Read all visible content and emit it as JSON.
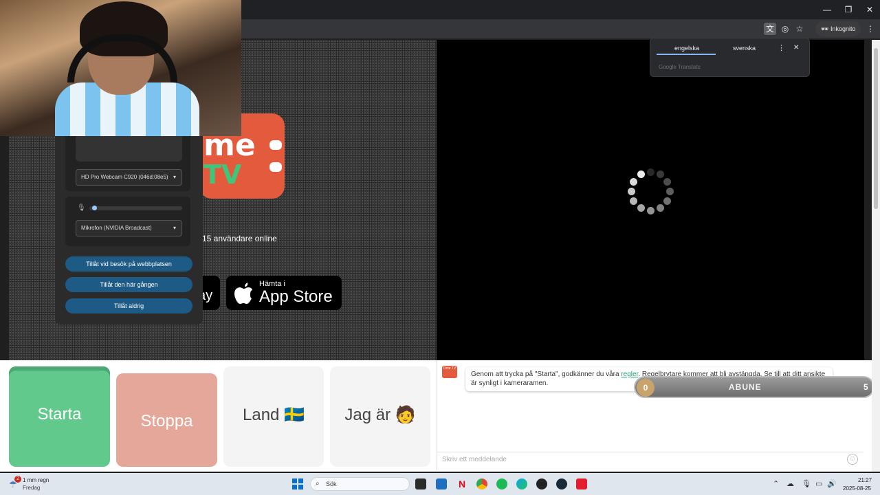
{
  "window_controls": {
    "minimize": "—",
    "restore": "❐",
    "close": "✕"
  },
  "browser": {
    "incognito_label": "Inkognito"
  },
  "translate_popup": {
    "tab_source": "engelska",
    "tab_target": "svenska",
    "footer": "Google Translate"
  },
  "ome": {
    "logo_top": "me",
    "logo_bottom": "TV",
    "online_text": "15 användare online",
    "badge": "Ome TV"
  },
  "app_store": {
    "small": "Hämta i",
    "big": "App Store",
    "google_fragment": "ay"
  },
  "permissions": {
    "camera_select": "HD Pro Webcam C920 (046d:08e5)",
    "mic_select": "Mikrofon (NVIDIA Broadcast)",
    "mic_level": 0.02,
    "buttons": [
      "Tillåt vid besök på webbplatsen",
      "Tillåt den här gången",
      "Tillåt aldrig"
    ]
  },
  "controls": {
    "start": "Starta",
    "stop": "Stoppa",
    "country": "Land",
    "country_flag": "🇸🇪",
    "gender": "Jag är",
    "gender_emoji": "🧑"
  },
  "chat": {
    "message_pre": "Genom att trycka på \"Starta\", godkänner du våra ",
    "message_link": "regler",
    "message_post": ". Regelbrytare kommer att bli avstängda. Se till att ditt ansikte är synligt i kameraramen.",
    "input_placeholder": "Skriv ett meddelande"
  },
  "abune": {
    "left_value": "0",
    "title": "ABUNE",
    "right_value": "5"
  },
  "taskbar": {
    "weather_badge": "2",
    "weather_line1": "1 mm regn",
    "weather_line2": "Fredag",
    "search_label": "Sök",
    "time": "21:27",
    "date": "2025-08-25"
  },
  "colors": {
    "ome_red": "#e35a3c",
    "start_green": "#62c98c",
    "stop_pink": "#e6a79b",
    "permission_blue": "#1d5b86"
  }
}
